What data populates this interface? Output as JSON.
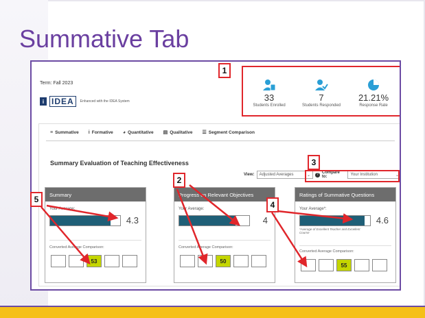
{
  "slide": {
    "title": "Summative Tab"
  },
  "header": {
    "term": "Term: Fall 2023",
    "logo_mark": "i",
    "logo_text": "IDEA",
    "logo_tagline": "Enhanced with the IDEA System"
  },
  "stats": [
    {
      "icon": "students-enrolled-icon",
      "value": "33",
      "label": "Students Enrolled"
    },
    {
      "icon": "students-responded-icon",
      "value": "7",
      "label": "Students Responded"
    },
    {
      "icon": "response-rate-pie-icon",
      "value": "21.21%",
      "label": "Response Rate"
    }
  ],
  "tabs": [
    {
      "icon": "summative-icon",
      "glyph": "≡",
      "label": "Summative"
    },
    {
      "icon": "formative-icon",
      "glyph": "i",
      "label": "Formative"
    },
    {
      "icon": "quantitative-icon",
      "glyph": "◕",
      "label": "Quantitative"
    },
    {
      "icon": "qualitative-icon",
      "glyph": "▤",
      "label": "Qualitative"
    },
    {
      "icon": "segment-comparison-icon",
      "glyph": "☰",
      "label": "Segment Comparison"
    }
  ],
  "main": {
    "section_title": "Summary Evaluation of Teaching Effectiveness",
    "view_label": "View:",
    "view_value": "Adjusted Averages",
    "help_glyph": "?",
    "compare_label": "Compare to:",
    "compare_value": "Your Institution",
    "chevron": "⌄"
  },
  "cards": [
    {
      "title": "Summary",
      "sub": "Your Average:",
      "score": "4.3",
      "fill_fraction": 0.86,
      "note": "",
      "cmp_label": "Converted Average Comparison:",
      "boxes": [
        "",
        "",
        "53",
        "",
        ""
      ],
      "highlight": 2
    },
    {
      "title": "Progress on Relevant Objectives",
      "sub": "Your Average:",
      "score": "4",
      "fill_fraction": 0.8,
      "note": "",
      "cmp_label": "Converted Average Comparison:",
      "boxes": [
        "",
        "",
        "50",
        "",
        ""
      ],
      "highlight": 2
    },
    {
      "title": "Ratings of Summative Questions",
      "sub": "Your Average*:",
      "score": "4.6",
      "fill_fraction": 0.92,
      "note": "*Average of Excellent Teacher and Excellent Course",
      "cmp_label": "Converted Average Comparison:",
      "boxes": [
        "",
        "",
        "55",
        "",
        ""
      ],
      "highlight": 2
    }
  ],
  "callouts": [
    "1",
    "2",
    "3",
    "4",
    "5"
  ],
  "colors": {
    "title": "#6a3fa0",
    "accent_red": "#e0262b",
    "bar": "#1f5f77",
    "highlight": "#c4d600",
    "card_head": "#6d6d6d"
  }
}
